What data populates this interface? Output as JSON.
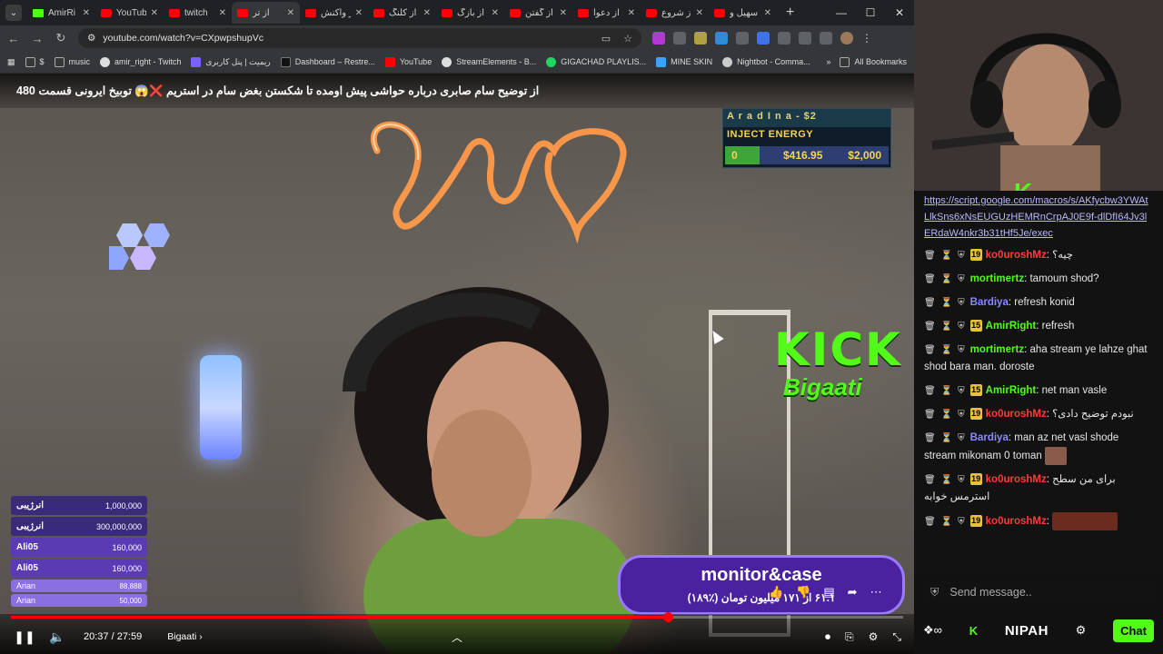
{
  "browser": {
    "tabs": [
      {
        "label": "AmirRi",
        "icon": "kick-icon",
        "active": false
      },
      {
        "label": "YouTub",
        "icon": "youtube-icon",
        "active": false
      },
      {
        "label": "twitch",
        "icon": "youtube-icon",
        "active": false
      },
      {
        "label": "از تر",
        "icon": "youtube-icon",
        "active": true
      },
      {
        "label": "از واکنش",
        "icon": "youtube-icon",
        "active": false
      },
      {
        "label": "از کلنگ",
        "icon": "youtube-icon",
        "active": false
      },
      {
        "label": "از بازگ",
        "icon": "youtube-icon",
        "active": false
      },
      {
        "label": "از گفتن",
        "icon": "youtube-icon",
        "active": false
      },
      {
        "label": "از دعوا",
        "icon": "youtube-icon",
        "active": false
      },
      {
        "label": "از شروع",
        "icon": "youtube-icon",
        "active": false
      },
      {
        "label": "سهیل و",
        "icon": "youtube-icon",
        "active": false
      }
    ],
    "url": "youtube.com/watch?v=CXpwpshupVc",
    "bookmarks": [
      "$",
      "music",
      "amir_right - Twitch",
      "ریمیت | پنل کاربری",
      "Dashboard – Restre...",
      "YouTube",
      "StreamElements - B...",
      "GIGACHAD PLAYLIS...",
      "MINE SKIN",
      "Nightbot - Comma..."
    ],
    "all_bookmarks": "All Bookmarks"
  },
  "video": {
    "title": "از توضیح سام صابری درباره حواشی پیش اومده تا شکستن بغض سام در استریم ❌😱 توبیخ ایرونی قسمت 480",
    "donation_box": {
      "name": "A r a d I n a - $2",
      "label": "INJECT ENERGY",
      "start": "0",
      "current": "$416.95",
      "goal": "$2,000"
    },
    "kick_logo": "KICK",
    "kick_sub": "Bigaati",
    "leaderboard": [
      {
        "name": "انرژیبی",
        "value": "1,000,000",
        "color": "#3a2a7a"
      },
      {
        "name": "انرژیبی",
        "value": "300,000,000",
        "color": "#3a2a7a"
      },
      {
        "name": "Ali05",
        "value": "160,000",
        "color": "#5b3bb4"
      },
      {
        "name": "Ali05",
        "value": "160,000",
        "color": "#5b3bb4"
      },
      {
        "name": "Arian",
        "value": "88,888",
        "color": "#8a6fe0"
      },
      {
        "name": "Arian",
        "value": "50,000",
        "color": "#8a6fe0"
      }
    ],
    "card": {
      "title": "monitor&case",
      "subtitle": "۶۱.۱ از ۱۷۱ میلیون تومان (٪۱۸۹)"
    },
    "player": {
      "time": "20:37 / 27:59",
      "chapter": "Bigaati",
      "progress": 0.736
    }
  },
  "chat": {
    "url": "https://script.google.com/macros/s/AKfycbw3YWAtLlkSns6xNsEUGUzHEMRnCrpAJ0E9f-dlDfI64Jv3lERdaW4nkr3b31tHf5Je/exec",
    "messages": [
      {
        "user": "ko0uroshMz",
        "color": "#ff3b3b",
        "badge": "19",
        "text": "چیه؟"
      },
      {
        "user": "mortimertz",
        "color": "#53fc18",
        "badge": "",
        "text": "tamoum shod?"
      },
      {
        "user": "Bardiya",
        "color": "#8a8aff",
        "badge": "",
        "text": "refresh konid"
      },
      {
        "user": "AmirRight",
        "color": "#53fc18",
        "badge": "15",
        "text": "refresh"
      },
      {
        "user": "mortimertz",
        "color": "#53fc18",
        "badge": "",
        "text": "aha stream ye lahze ghat shod bara man. doroste"
      },
      {
        "user": "AmirRight",
        "color": "#53fc18",
        "badge": "15",
        "text": "net man vasle"
      },
      {
        "user": "ko0uroshMz",
        "color": "#ff3b3b",
        "badge": "19",
        "text": "نبودم توضیح دادی؟"
      },
      {
        "user": "Bardiya",
        "color": "#8a8aff",
        "badge": "",
        "text": "man az net vasl shode stream mikonam 0 toman"
      },
      {
        "user": "ko0uroshMz",
        "color": "#ff3b3b",
        "badge": "19",
        "text": "برای من سطح استرمس خوابه"
      },
      {
        "user": "ko0uroshMz",
        "color": "#ff3b3b",
        "badge": "19",
        "text": ""
      }
    ],
    "send_placeholder": "Send message..",
    "nipah": "NIPAH",
    "chat_button": "Chat"
  }
}
